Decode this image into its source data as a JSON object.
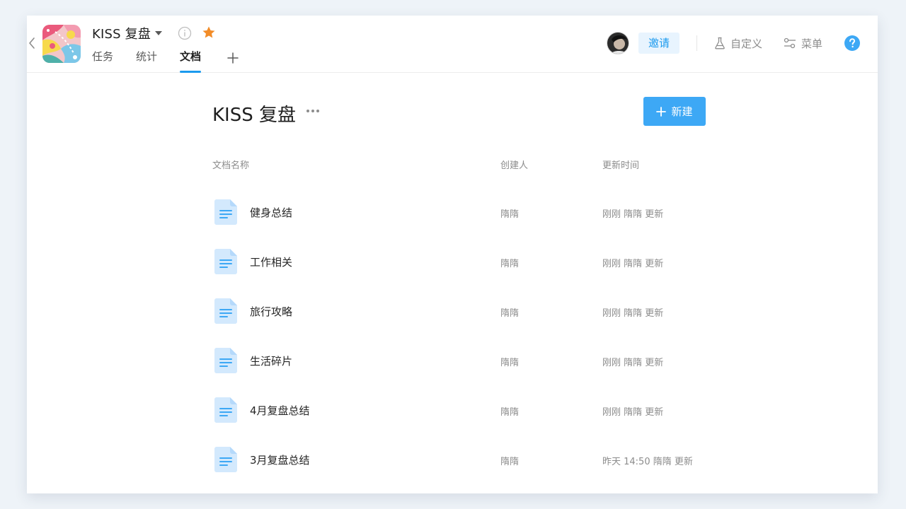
{
  "project": {
    "name": "KISS 复盘",
    "starred": true
  },
  "tabs": [
    {
      "label": "任务",
      "active": false
    },
    {
      "label": "统计",
      "active": false
    },
    {
      "label": "文档",
      "active": true
    }
  ],
  "header_actions": {
    "invite_label": "邀请",
    "customize_label": "自定义",
    "menu_label": "菜单"
  },
  "page": {
    "title": "KISS 复盘",
    "new_button_label": "新建"
  },
  "columns": {
    "name": "文档名称",
    "creator": "创建人",
    "updated": "更新时间"
  },
  "documents": [
    {
      "name": "健身总结",
      "creator": "隋隋",
      "updated": "刚刚 隋隋 更新"
    },
    {
      "name": "工作相关",
      "creator": "隋隋",
      "updated": "刚刚 隋隋 更新"
    },
    {
      "name": "旅行攻略",
      "creator": "隋隋",
      "updated": "刚刚 隋隋 更新"
    },
    {
      "name": "生活碎片",
      "creator": "隋隋",
      "updated": "刚刚 隋隋 更新"
    },
    {
      "name": "4月复盘总结",
      "creator": "隋隋",
      "updated": "刚刚 隋隋 更新"
    },
    {
      "name": "3月复盘总结",
      "creator": "隋隋",
      "updated": "昨天 14:50 隋隋 更新"
    }
  ],
  "colors": {
    "accent": "#1b9aee",
    "primary_button": "#3da8f5",
    "star": "#f28c28",
    "doc_icon_bg": "#d3e9fd",
    "background": "#eef3f8"
  }
}
